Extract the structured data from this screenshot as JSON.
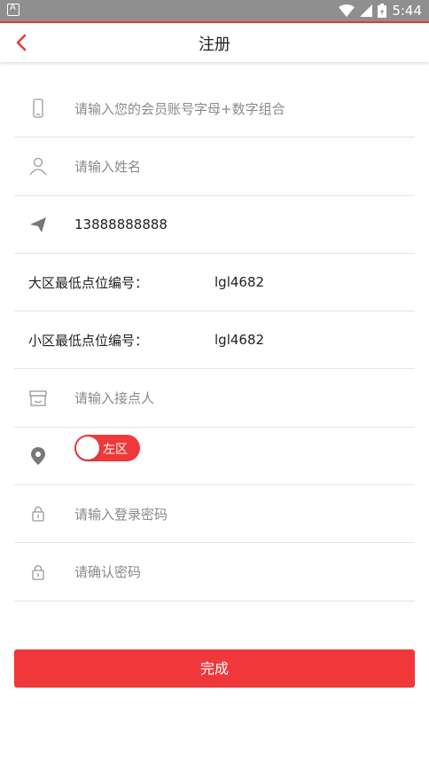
{
  "statusbar": {
    "time": "5:44"
  },
  "header": {
    "title": "注册",
    "back_icon": "chevron-left-icon"
  },
  "form": {
    "account": {
      "placeholder": "请输入您的会员账号字母+数字组合",
      "icon": "phone-icon"
    },
    "name": {
      "placeholder": "请输入姓名",
      "icon": "user-icon"
    },
    "phone": {
      "value": "13888888888",
      "icon": "send-icon"
    },
    "big_area": {
      "label": "大区最低点位编号：",
      "value": "lgl4682"
    },
    "small_area": {
      "label": "小区最低点位编号：",
      "value": "lgl4682"
    },
    "contact": {
      "placeholder": "请输入接点人",
      "icon": "store-icon"
    },
    "area_toggle": {
      "label": "左区",
      "icon": "location-pin-icon"
    },
    "password": {
      "placeholder": "请输入登录密码",
      "icon": "lock-icon"
    },
    "confirm_password": {
      "placeholder": "请确认密码",
      "icon": "lock-icon"
    }
  },
  "submit_label": "完成",
  "colors": {
    "accent": "#f0383a",
    "placeholder": "#8a8a8a",
    "divider": "#e5e5e5"
  }
}
